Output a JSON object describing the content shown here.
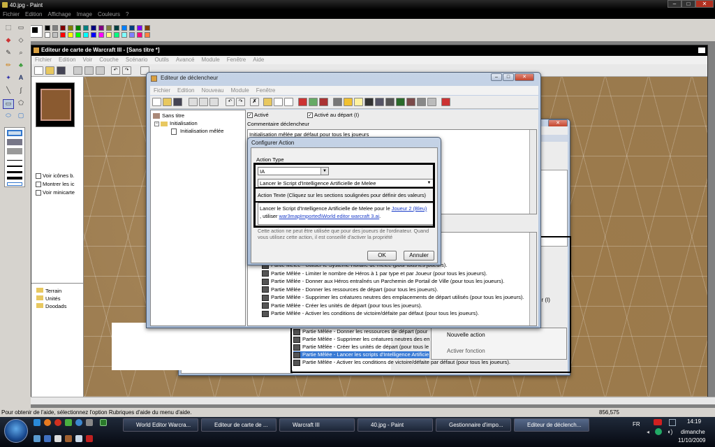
{
  "paint": {
    "title": "40.jpg - Paint",
    "menu": [
      "Fichier",
      "Edition",
      "Affichage",
      "Image",
      "Couleurs",
      "?"
    ],
    "status_text": "Pour obtenir de l'aide, sélectionnez l'option Rubriques d'aide du menu d'aide.",
    "coords": "856,575",
    "title_controls": [
      "–",
      "□",
      "✕"
    ]
  },
  "world_editor": {
    "title": "Editeur de carte de Warcraft III - [Sans titre *]",
    "menu": [
      "Fichier",
      "Edition",
      "Voir",
      "Couche",
      "Scénario",
      "Outils",
      "Avancé",
      "Module",
      "Fenêtre",
      "Aide"
    ],
    "left_panel": {
      "checks": [
        "Voir icônes b.",
        "Montrer les ic",
        "Voir minicarte"
      ],
      "folders": [
        "Terrain",
        "Unités",
        "Doodads"
      ]
    }
  },
  "trigger_editor": {
    "title": "Editeur de déclencheur",
    "menu": [
      "Fichier",
      "Edition",
      "Nouveau",
      "Module",
      "Fenêtre"
    ],
    "tree": {
      "root": "Sans titre",
      "folder": "Initialisation",
      "item": "Initialisation mêlée"
    },
    "check_active": "Activé",
    "check_start": "Activé au départ (I)",
    "comment_label": "Commentaire déclencheur",
    "comment_text": "Initialisation mêlée par défaut pour tous les joueurs",
    "actions": [
      "Partie Mêlée - Utiliser le Système Horaire de mêlée (pour tous les joueurs).",
      "Partie Mêlée - Limiter le nombre de Héros à 1 par type et par Joueur (pour tous les joueurs).",
      "Partie Mêlée - Donner aux Héros entraînés un Parchemin de Portail de Ville (pour tous les joueurs).",
      "Partie Mêlée - Donner les ressources de départ (pour tous les joueurs).",
      "Partie Mêlée - Supprimer les créatures neutres des emplacements de départ utilisés (pour tous les joueurs).",
      "Partie Mêlée - Créer les unités de départ (pour tous les joueurs).",
      "Partie Mêlée - Activer les conditions de victoire/défaite par défaut (pour tous les joueurs)."
    ]
  },
  "behind_window": {
    "rows": [
      "Partie Mêlée - Donner les ressources de départ (pour",
      "Partie Mêlée - Supprimer les créatures neutres des em",
      "Partie Mêlée - Créer les unités de départ (pour tous le",
      "Partie Mêlée - Lancer les scripts d'Intelligence Artificie",
      "Partie Mêlée - Activer les conditions de victoire/défaite par défaut (pour tous les joueurs)."
    ],
    "selected_index": 3,
    "context_menu": [
      "Nouvelle action",
      "Activer fonction"
    ],
    "side_text": "ur (I)"
  },
  "configure_action": {
    "title": "Configurer Action",
    "type_label": "Action Type",
    "type_value": "IA",
    "action_value": "Lancer le Script d'Intelligence Artificielle de Melee",
    "text_label": "Action Texte (Cliquez sur les sections soulignées pour définir des valeurs)",
    "text_prefix": "Lancer le Script d'Intelligence Artificielle de Melee pour le ",
    "text_link1": "Joueur 2 (Bleu)",
    "text_mid": ", utiliser ",
    "text_link2": "war3mapImported\\World editor warcraft 3.ai",
    "text_suffix": ".",
    "note": "Cette action ne peut être utilisée que pour des joueurs de l'ordinateur. Quand vous utilisez cette action, il est conseillé d'activer la propriété",
    "ok": "OK",
    "cancel": "Annuler"
  },
  "taskbar": {
    "buttons": [
      "World Editor Warcra...",
      "Editeur de carte de ...",
      "Warcraft III",
      "40.jpg - Paint",
      "Gestionnaire d'impo...",
      "Editeur de déclench..."
    ],
    "lang": "FR",
    "time": "14:19",
    "day": "dimanche",
    "date": "11/10/2009"
  },
  "colors": {
    "palette": [
      "#000000",
      "#808080",
      "#800000",
      "#808000",
      "#008000",
      "#008080",
      "#000080",
      "#800080",
      "#808040",
      "#004040",
      "#0080ff",
      "#004080",
      "#8000ff",
      "#804000",
      "#ffffff",
      "#c0c0c0",
      "#ff0000",
      "#ffff00",
      "#00ff00",
      "#00ffff",
      "#0000ff",
      "#ff00ff",
      "#ffff80",
      "#00ff80",
      "#80ffff",
      "#8080ff",
      "#ff0080",
      "#ff8040"
    ]
  }
}
